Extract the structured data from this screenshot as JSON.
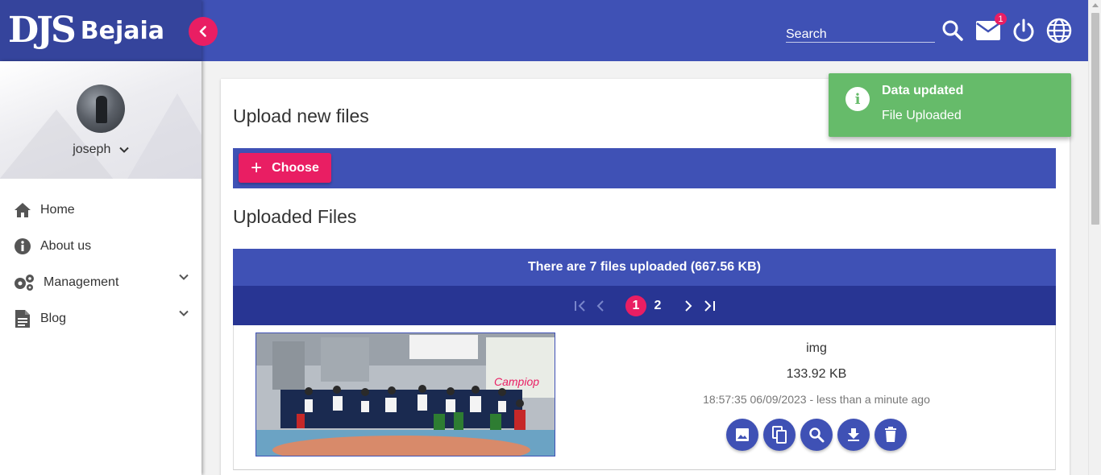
{
  "brand": {
    "logo_text": "DJS",
    "name": "Bejaia"
  },
  "header": {
    "search_placeholder": "Search",
    "mail_count": "1",
    "icons": [
      "search-icon",
      "mail-icon",
      "power-icon",
      "globe-icon"
    ]
  },
  "sidebar": {
    "username": "joseph",
    "items": [
      {
        "label": "Home",
        "icon": "home-icon"
      },
      {
        "label": "About us",
        "icon": "info-icon"
      },
      {
        "label": "Management",
        "icon": "gears-icon",
        "expandable": true
      },
      {
        "label": "Blog",
        "icon": "document-icon",
        "expandable": true
      }
    ]
  },
  "upload": {
    "title": "Upload new files",
    "choose_label": "Choose"
  },
  "files": {
    "title": "Uploaded Files",
    "summary": "There are 7 files uploaded (667.56 KB)",
    "pagination": {
      "pages": [
        "1",
        "2"
      ],
      "current": "1"
    },
    "items": [
      {
        "name": "img",
        "size": "133.92 KB",
        "date": "18:57:35 06/09/2023 - less than a minute ago",
        "actions": [
          "image-icon",
          "copy-icon",
          "zoom-icon",
          "download-icon",
          "delete-icon"
        ]
      }
    ]
  },
  "toast": {
    "title": "Data updated",
    "message": "File Uploaded",
    "icon": "info-icon"
  },
  "colors": {
    "primary": "#3f51b5",
    "primary_dark": "#283593",
    "accent": "#e91e63",
    "success": "#66bb6a"
  }
}
